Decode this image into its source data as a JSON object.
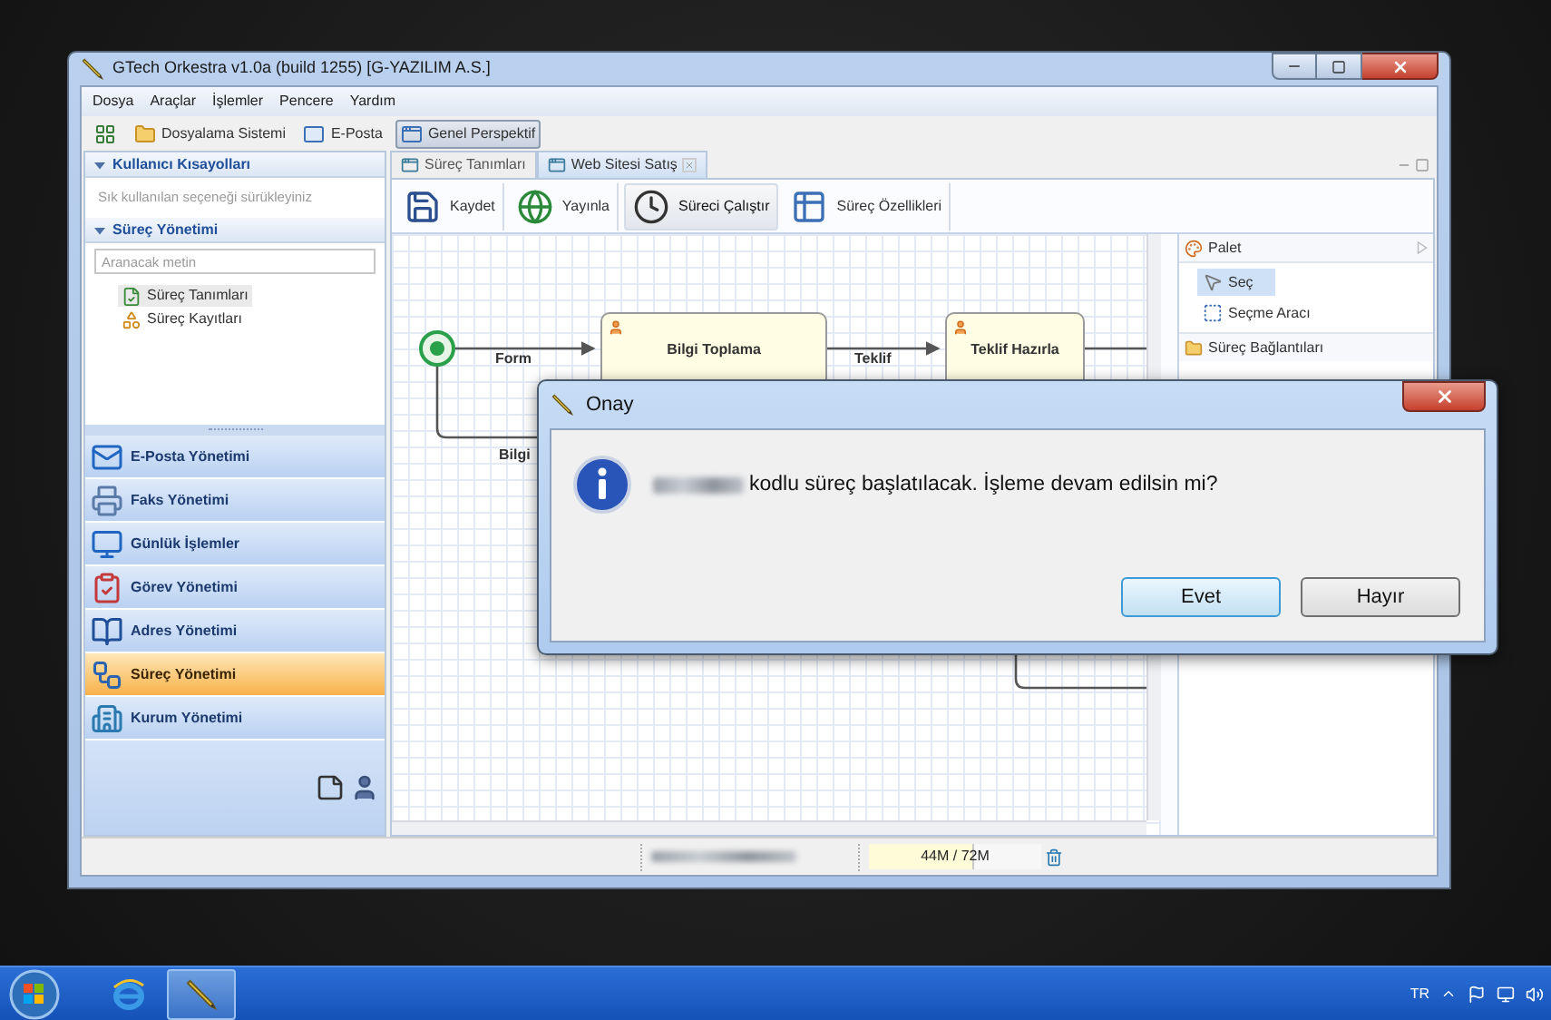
{
  "window": {
    "title": "GTech Orkestra v1.0a (build 1255) [G-YAZILIM A.S.]"
  },
  "menu": [
    "Dosya",
    "Araçlar",
    "İşlemler",
    "Pencere",
    "Yardım"
  ],
  "toolbar": [
    {
      "kind": "grid",
      "selected": false
    },
    {
      "kind": "folder",
      "label": "Dosyalama Sistemi",
      "selected": false
    },
    {
      "kind": "mail",
      "label": "E-Posta",
      "selected": false
    },
    {
      "kind": "perspective",
      "label": "Genel Perspektif",
      "selected": true
    }
  ],
  "sidebar": {
    "shortcuts": {
      "title": "Kullanıcı Kısayolları",
      "expanded": true,
      "hint": "Sık kullanılan seçeneği sürükleyiniz"
    },
    "process": {
      "title": "Süreç Yönetimi",
      "expanded": true,
      "search": {
        "placeholder": "Aranacak metin"
      },
      "items": [
        {
          "kind": "definitions",
          "label": "Süreç Tanımları",
          "selected": true
        },
        {
          "kind": "records",
          "label": "Süreç Kayıtları",
          "selected": false
        }
      ]
    },
    "nav": [
      {
        "kind": "email",
        "label": "E-Posta Yönetimi",
        "selected": false
      },
      {
        "kind": "fax",
        "label": "Faks Yönetimi",
        "selected": false
      },
      {
        "kind": "daily",
        "label": "Günlük İşlemler",
        "selected": false
      },
      {
        "kind": "task",
        "label": "Görev Yönetimi",
        "selected": false
      },
      {
        "kind": "address",
        "label": "Adres Yönetimi",
        "selected": false
      },
      {
        "kind": "process",
        "label": "Süreç Yönetimi",
        "selected": true
      },
      {
        "kind": "org",
        "label": "Kurum Yönetimi",
        "selected": false
      }
    ]
  },
  "editor": {
    "tabs": [
      {
        "label": "Süreç Tanımları",
        "selected": false,
        "closable": false
      },
      {
        "label": "Web Sitesi Satış",
        "selected": true,
        "closable": true
      }
    ],
    "toolbar": [
      {
        "kind": "save",
        "label": "Kaydet",
        "pressed": false
      },
      {
        "kind": "publish",
        "label": "Yayınla",
        "pressed": false
      },
      {
        "kind": "run",
        "label": "Süreci Çalıştır",
        "pressed": true
      },
      {
        "kind": "properties",
        "label": "Süreç Özellikleri",
        "pressed": false
      }
    ],
    "diagram": {
      "nodes": [
        {
          "title": "Bilgi Toplama"
        },
        {
          "title": "Teklif Hazırla"
        }
      ],
      "edges": [
        {
          "label": "Form"
        },
        {
          "label": "Teklif"
        },
        {
          "label": "Bilgi"
        }
      ]
    },
    "palette": {
      "title": "Palet",
      "tools": [
        {
          "kind": "select",
          "label": "Seç",
          "selected": true
        },
        {
          "kind": "marquee",
          "label": "Seçme Aracı",
          "selected": false
        }
      ],
      "drawers": [
        {
          "label": "Süreç Bağlantıları"
        }
      ]
    }
  },
  "status_bar": {
    "memory": {
      "text": "44M / 72M",
      "level": 0.61
    }
  },
  "dialog": {
    "title": "Onay",
    "message": "kodlu süreç başlatılacak. İşleme devam edilsin mi?",
    "buttons": [
      {
        "label": "Evet",
        "default": true
      },
      {
        "label": "Hayır",
        "default": false
      }
    ]
  },
  "taskbar": {
    "apps": [
      {
        "kind": "browser",
        "active": false
      },
      {
        "kind": "orkestra",
        "active": true
      }
    ],
    "language": "TR"
  }
}
